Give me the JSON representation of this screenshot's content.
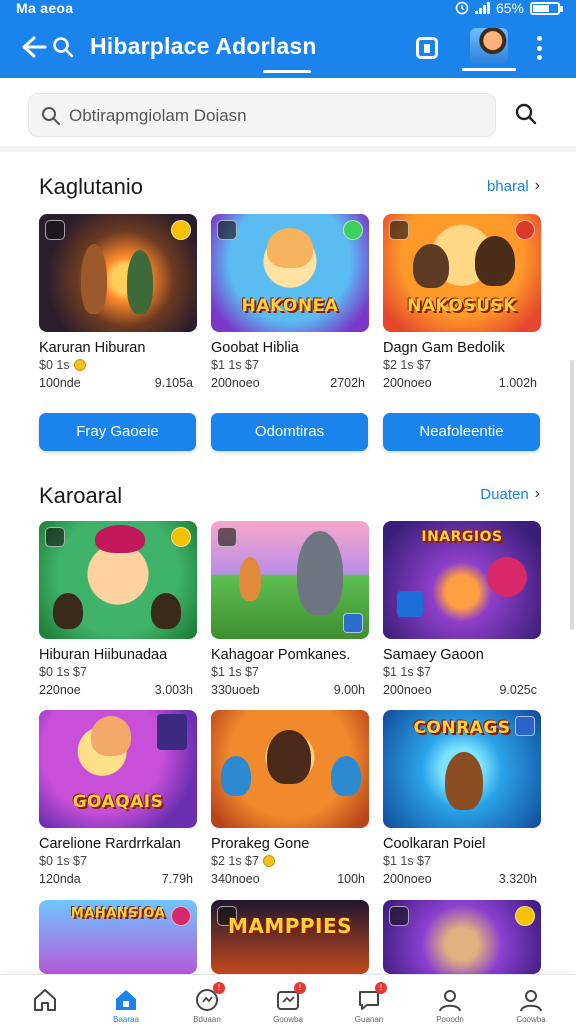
{
  "status_bar": {
    "carrier": "Ma aeoa",
    "battery_text": "65%",
    "battery_level": 0.65
  },
  "header": {
    "title": "Hibarplace Adorlasn"
  },
  "search": {
    "placeholder": "Obtirapmgiolam Doiasn"
  },
  "sections": [
    {
      "title": "Kaglutanio",
      "see_all": "bharal",
      "cards": [
        {
          "name": "Karuran Hiburan",
          "price": "$0 1s",
          "downloads": "100nde",
          "size": "9.105a",
          "art": "campfire"
        },
        {
          "name": "Goobat Hiblia",
          "price": "$1 1s $7",
          "downloads": "200noeo",
          "size": "2702h",
          "art": "HAKONEA"
        },
        {
          "name": "Dagn Gam Bedolik",
          "price": "$2 1s $7",
          "downloads": "200noeo",
          "size": "1.002h",
          "art": "NAKOSUSK"
        }
      ],
      "buttons": [
        "Fray Gaoeie",
        "Odomtiras",
        "Neafoleentie"
      ]
    },
    {
      "title": "Karoaral",
      "see_all": "Duaten",
      "cards": [
        {
          "name": "Hiburan Hiibunadaa",
          "price": "$0 1s $7",
          "downloads": "220noe",
          "size": "3.003h",
          "art": "kids"
        },
        {
          "name": "Kahagoar Pomkanes.",
          "price": "$1 1s $7",
          "downloads": "330uoeb",
          "size": "9.00h",
          "art": "monster"
        },
        {
          "name": "Samaey Gaoon",
          "price": "$1 1s $7",
          "downloads": "200noeo",
          "size": "9.025c",
          "art": "INARGIOS"
        }
      ]
    },
    {
      "title": "",
      "see_all": "",
      "cards": [
        {
          "name": "Carelione Rardrrkalan",
          "price": "$0 1s $7",
          "downloads": "120nda",
          "size": "7.79h",
          "art": "GOAQAIS"
        },
        {
          "name": "Prorakeg Gone",
          "price": "$2 1s $7",
          "downloads": "340noeo",
          "size": "100h",
          "art": "heroes"
        },
        {
          "name": "Coolkaran Poiel",
          "price": "$1 1s $7",
          "downloads": "200noeo",
          "size": "3.320h",
          "art": "CONRAGS"
        }
      ]
    },
    {
      "title": "",
      "see_all": "",
      "cards": [
        {
          "name": "",
          "art": "MAHANSIOA"
        },
        {
          "name": "",
          "art": "MAMPPIES"
        },
        {
          "name": "",
          "art": "pirate"
        }
      ]
    }
  ],
  "bottom_nav": [
    {
      "label": "",
      "icon": "home-icon"
    },
    {
      "label": "Baaraa",
      "icon": "store-icon"
    },
    {
      "label": "Bduaan",
      "icon": "gamepad-icon"
    },
    {
      "label": "Goowba",
      "icon": "download-icon"
    },
    {
      "label": "Guanan",
      "icon": "chat-icon"
    },
    {
      "label": "Pooodn",
      "icon": "profile-icon"
    },
    {
      "label": "Coowba",
      "icon": "account-icon"
    }
  ],
  "colors": {
    "primary": "#1a84ec",
    "link": "#1a7fe0"
  }
}
